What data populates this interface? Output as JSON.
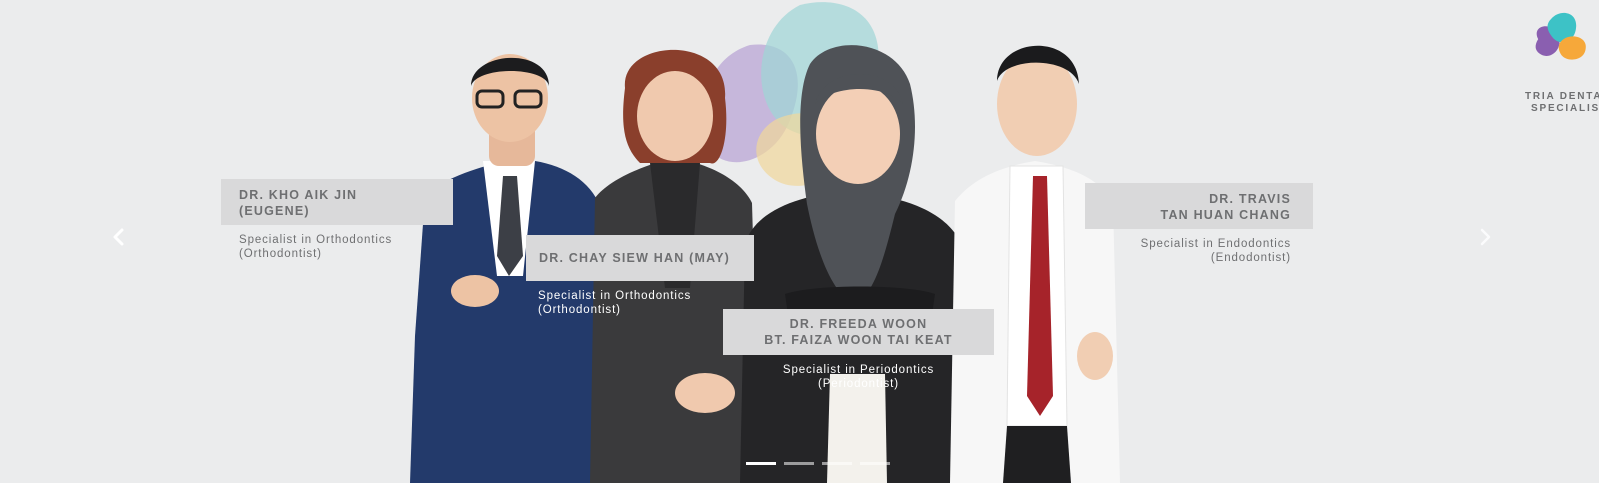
{
  "brand": {
    "logo_line1": "TRIA DENTAL",
    "logo_line2": "SPECIALISTS",
    "colors": {
      "teal": "#3dc2c6",
      "purple": "#8a5fb0",
      "orange": "#f6a83a"
    }
  },
  "navigation": {
    "prev_icon": "chevron-left-icon",
    "next_icon": "chevron-right-icon"
  },
  "doctors": [
    {
      "name_line1": "DR. KHO AIK JIN",
      "name_line2": "(EUGENE)",
      "specialty": "Specialist in Orthodontics",
      "role": "(Orthodontist)"
    },
    {
      "name_line1": "DR. CHAY SIEW HAN (MAY)",
      "specialty": "Specialist in Orthodontics",
      "role": "(Orthodontist)"
    },
    {
      "name_line1": "DR. FREEDA WOON",
      "name_line2": "BT. FAIZA WOON TAI KEAT",
      "specialty": "Specialist in Periodontics",
      "role": "(Periodontist)"
    },
    {
      "name_line1": "DR. TRAVIS",
      "name_line2": "TAN HUAN CHANG",
      "specialty": "Specialist in Endodontics",
      "role": "(Endodontist)"
    }
  ],
  "pagination": {
    "count": 4,
    "active": 0
  }
}
